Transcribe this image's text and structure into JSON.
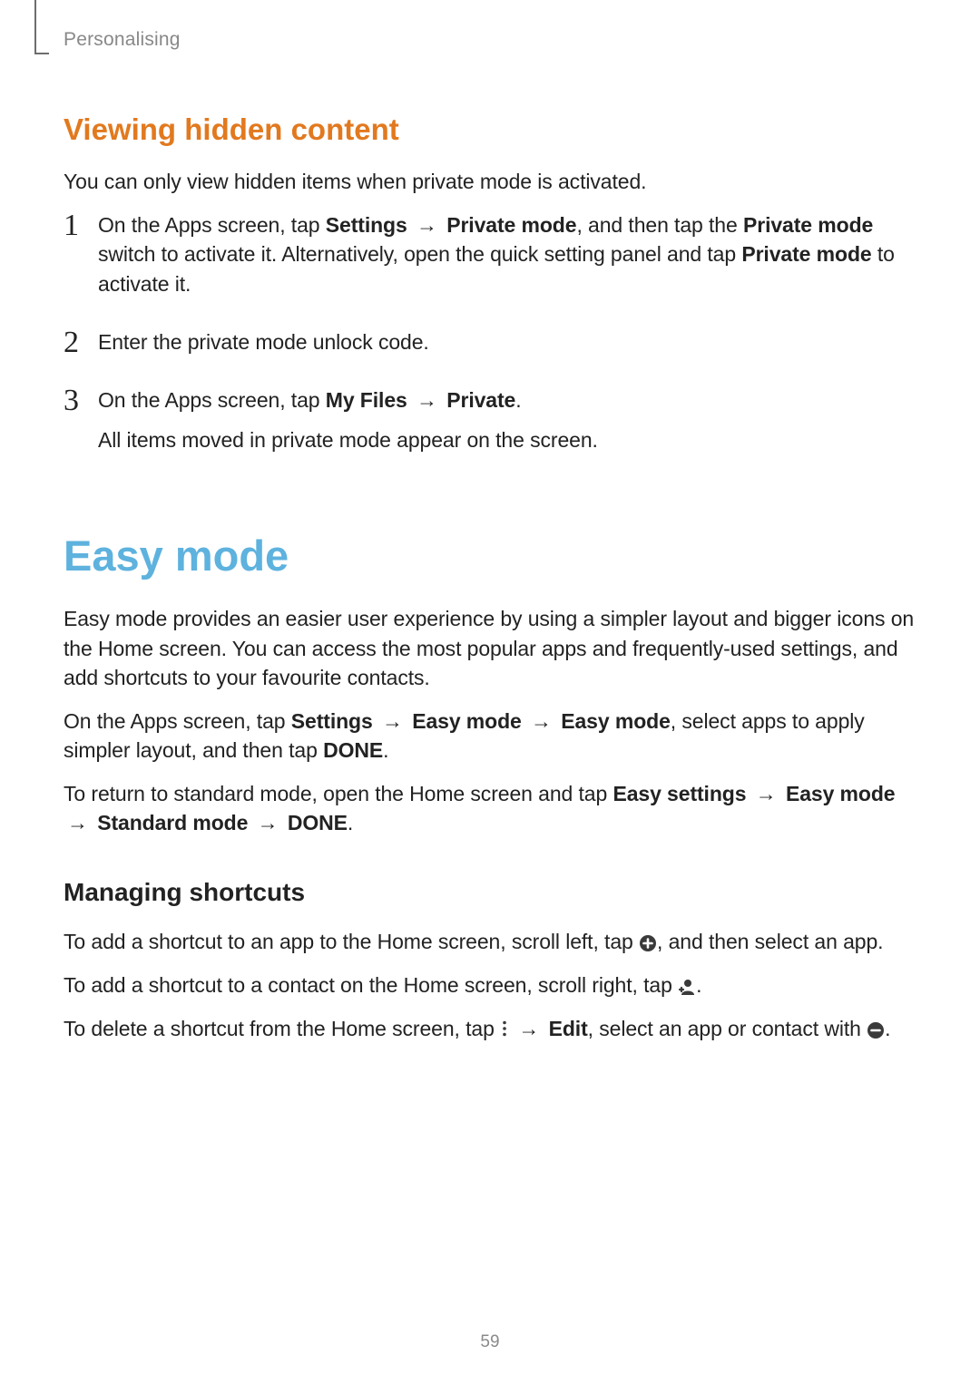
{
  "header": {
    "section": "Personalising"
  },
  "hidden": {
    "heading": "Viewing hidden content",
    "intro": "You can only view hidden items when private mode is activated.",
    "steps": {
      "s1": {
        "num": "1",
        "t_pre": "On the Apps screen, tap ",
        "t_settings": "Settings",
        "t_arrow1": "→",
        "t_privateMode": "Private mode",
        "t_mid1": ", and then tap the ",
        "t_privateModeSwitch": "Private mode",
        "t_mid2": " switch to activate it. Alternatively, open the quick setting panel and tap ",
        "t_privateMode2": "Private mode",
        "t_end": " to activate it."
      },
      "s2": {
        "num": "2",
        "text": "Enter the private mode unlock code."
      },
      "s3": {
        "num": "3",
        "t_pre": "On the Apps screen, tap ",
        "t_myFiles": "My Files",
        "t_arrow": "→",
        "t_private": "Private",
        "t_period": ".",
        "line2": "All items moved in private mode appear on the screen."
      }
    }
  },
  "easy": {
    "heading": "Easy mode",
    "intro": "Easy mode provides an easier user experience by using a simpler layout and bigger icons on the Home screen. You can access the most popular apps and frequently-used settings, and add shortcuts to your favourite contacts.",
    "para2": {
      "t_pre": "On the Apps screen, tap ",
      "t_settings": "Settings",
      "t_arrow1": "→",
      "t_easymode1": "Easy mode",
      "t_arrow2": "→",
      "t_easymode2": "Easy mode",
      "t_mid": ", select apps to apply simpler layout, and then tap ",
      "t_done": "DONE",
      "t_period": "."
    },
    "para3": {
      "t_pre": "To return to standard mode, open the Home screen and tap ",
      "t_easysettings": "Easy settings",
      "t_arrow1": "→",
      "t_easymode": "Easy mode",
      "t_arrow2": "→",
      "t_standard": "Standard mode",
      "t_arrow3": "→",
      "t_done": "DONE",
      "t_period": "."
    },
    "managing": {
      "heading": "Managing shortcuts",
      "p1_pre": "To add a shortcut to an app to the Home screen, scroll left, tap ",
      "p1_post": ", and then select an app.",
      "p2_pre": "To add a shortcut to a contact on the Home screen, scroll right, tap ",
      "p2_post": ".",
      "p3_pre": "To delete a shortcut from the Home screen, tap ",
      "p3_arrow": "→",
      "p3_edit": "Edit",
      "p3_mid": ", select an app or contact with ",
      "p3_end": "."
    }
  },
  "pageNumber": "59"
}
